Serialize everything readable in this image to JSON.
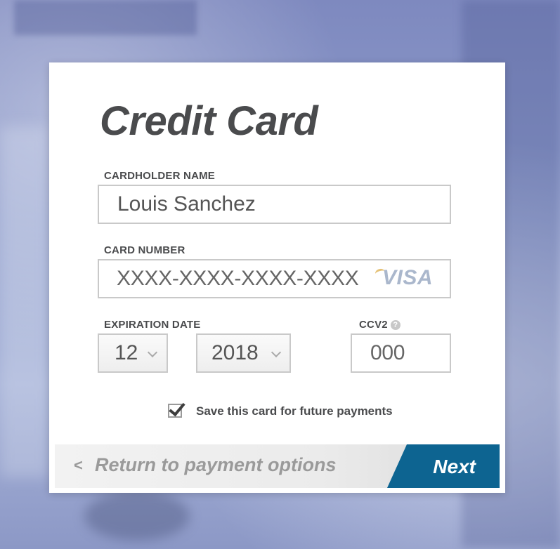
{
  "form": {
    "title": "Credit Card",
    "cardholder_label": "CARDHOLDER NAME",
    "cardholder_value": "Louis Sanchez",
    "card_number_label": "CARD NUMBER",
    "card_number_placeholder": "XXXX-XXXX-XXXX-XXXX",
    "card_brand": "VISA",
    "expiration_label": "EXPIRATION DATE",
    "exp_month_value": "12",
    "exp_year_value": "2018",
    "ccv_label": "CCV2",
    "ccv_help": "?",
    "ccv_placeholder": "000",
    "save_card_label": "Save this card for future payments",
    "save_card_checked": true
  },
  "footer": {
    "back_chevron": "<",
    "back_label": "Return to payment options",
    "next_label": "Next"
  },
  "colors": {
    "accent": "#0d6491",
    "title_text": "#4a4b4d",
    "muted_text": "#9a9a9a"
  },
  "icons": [
    "visa-logo-icon",
    "help-icon",
    "checkmark-icon",
    "chevron-left-icon",
    "chevron-down-icon"
  ]
}
